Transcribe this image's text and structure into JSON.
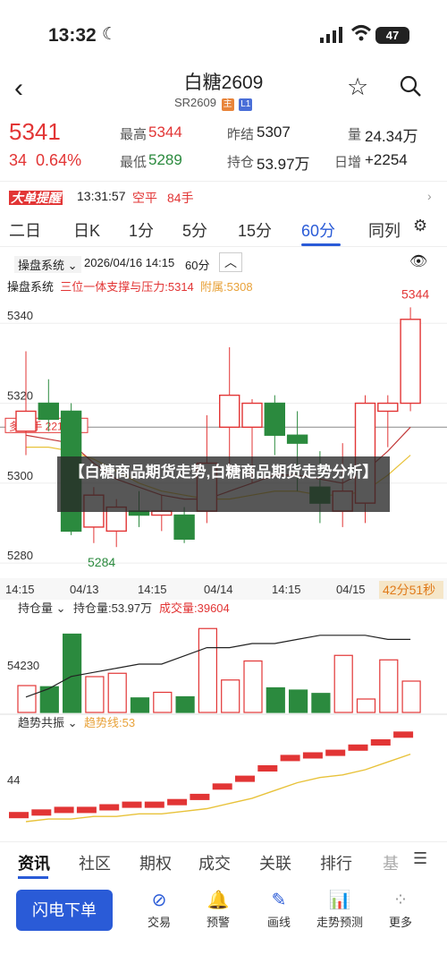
{
  "status": {
    "time": "13:32",
    "battery": "47"
  },
  "header": {
    "title": "白糖2609",
    "code": "SR2609",
    "tag_main": "主",
    "tag_l1": "L1"
  },
  "quote": {
    "price": "5341",
    "change": "34",
    "change_pct": "0.64%",
    "high_label": "最高",
    "high": "5344",
    "low_label": "最低",
    "low": "5289",
    "prev_label": "昨结",
    "prev": "5307",
    "oi_label": "持仓",
    "oi": "53.97万",
    "vol_label": "量",
    "vol": "24.34万",
    "daily_label": "日增",
    "daily": "+2254"
  },
  "alert": {
    "logo": "大单提醒",
    "time": "13:31:57",
    "type": "空平",
    "qty": "84手"
  },
  "tabs": [
    "二日",
    "日K",
    "1分",
    "5分",
    "15分",
    "60分",
    "同列"
  ],
  "active_tab": "60分",
  "chart_bar": {
    "indicator": "操盘系统",
    "date": "2026/04/16 14:15",
    "period": "60分"
  },
  "indicator_line": {
    "name": "操盘系统",
    "desc": "三位一体支撑与压力:5314",
    "extra": "附属:5308"
  },
  "main_chart": {
    "price_labels": [
      "5340",
      "5320",
      "5300",
      "5280"
    ],
    "hi_label": "5344",
    "lo_label": "5284",
    "hold_label": "多13手 2210元",
    "x_labels": [
      "14:15",
      "04/13",
      "14:15",
      "04/14",
      "14:15",
      "04/15"
    ],
    "countdown": "42分51秒"
  },
  "sub1": {
    "name": "持仓量",
    "oi": "持仓量:53.97万",
    "vol": "成交量:39604",
    "level": "54230"
  },
  "sub2": {
    "name": "趋势共振",
    "line": "趋势线:53",
    "level": "44"
  },
  "banner": "【白糖商品期货走势,白糖商品期货走势分析】",
  "bottom_tabs": [
    "资讯",
    "社区",
    "期权",
    "成交",
    "关联",
    "排行",
    "基"
  ],
  "toolbar": {
    "flash": "闪电下单",
    "items": [
      "交易",
      "预警",
      "画线",
      "走势预测",
      "更多"
    ]
  },
  "chart_data": [
    {
      "type": "candlestick",
      "title": "",
      "ylabel": "",
      "y_ticks": [
        5340,
        5320,
        5300,
        5280
      ],
      "x_ticks": [
        "14:15",
        "04/13",
        "14:15",
        "04/14",
        "14:15",
        "04/15"
      ],
      "candles": [
        {
          "o": 5313,
          "c": 5318,
          "h": 5333,
          "l": 5307
        },
        {
          "o": 5320,
          "c": 5316,
          "h": 5326,
          "l": 5313
        },
        {
          "o": 5318,
          "c": 5288,
          "h": 5320,
          "l": 5287
        },
        {
          "o": 5289,
          "c": 5297,
          "h": 5299,
          "l": 5285
        },
        {
          "o": 5288,
          "c": 5294,
          "h": 5296,
          "l": 5284
        },
        {
          "o": 5293,
          "c": 5292,
          "h": 5298,
          "l": 5289
        },
        {
          "o": 5292,
          "c": 5293,
          "h": 5297,
          "l": 5288
        },
        {
          "o": 5292,
          "c": 5286,
          "h": 5294,
          "l": 5285
        },
        {
          "o": 5293,
          "c": 5305,
          "h": 5317,
          "l": 5290
        },
        {
          "o": 5314,
          "c": 5322,
          "h": 5334,
          "l": 5303
        },
        {
          "o": 5314,
          "c": 5320,
          "h": 5321,
          "l": 5300
        },
        {
          "o": 5320,
          "c": 5312,
          "h": 5322,
          "l": 5307
        },
        {
          "o": 5312,
          "c": 5310,
          "h": 5318,
          "l": 5298
        },
        {
          "o": 5299,
          "c": 5295,
          "h": 5308,
          "l": 5290
        },
        {
          "o": 5293,
          "c": 5298,
          "h": 5310,
          "l": 5289
        },
        {
          "o": 5295,
          "c": 5320,
          "h": 5322,
          "l": 5290
        },
        {
          "o": 5318,
          "c": 5320,
          "h": 5322,
          "l": 5309
        },
        {
          "o": 5320,
          "c": 5341,
          "h": 5344,
          "l": 5318
        }
      ],
      "ma": [
        5312,
        5311,
        5310,
        5305,
        5301,
        5299,
        5297,
        5296,
        5296,
        5298,
        5300,
        5302,
        5302,
        5301,
        5300,
        5303,
        5308,
        5314
      ],
      "ma2": [
        5309,
        5309,
        5308,
        5306,
        5303,
        5300,
        5298,
        5297,
        5296,
        5296,
        5297,
        5298,
        5298,
        5297,
        5297,
        5298,
        5302,
        5307
      ]
    },
    {
      "type": "bar",
      "title": "",
      "series": [
        {
          "name": "持仓量",
          "values": [
            53.2,
            53.4,
            53.7,
            53.8,
            53.9,
            54.0,
            54.0,
            54.2,
            54.4,
            54.4,
            54.5,
            54.5,
            54.6,
            54.7,
            54.7,
            54.7,
            54.6,
            54.6
          ]
        },
        {
          "name": "成交量",
          "values": [
            24,
            23,
            70,
            32,
            35,
            13,
            18,
            14,
            75,
            29,
            46,
            22,
            20,
            17,
            51,
            12,
            47,
            28
          ]
        }
      ]
    },
    {
      "type": "bar",
      "title": "",
      "series": [
        {
          "name": "趋势共振",
          "values": [
            2,
            3,
            4,
            4,
            5,
            6,
            6,
            7,
            9,
            13,
            16,
            20,
            24,
            25,
            26,
            28,
            30,
            33
          ]
        },
        {
          "name": "趋势线",
          "values": [
            0,
            1,
            1,
            2,
            2,
            3,
            3,
            4,
            5,
            7,
            9,
            12,
            15,
            17,
            18,
            20,
            23,
            26
          ]
        }
      ]
    }
  ]
}
